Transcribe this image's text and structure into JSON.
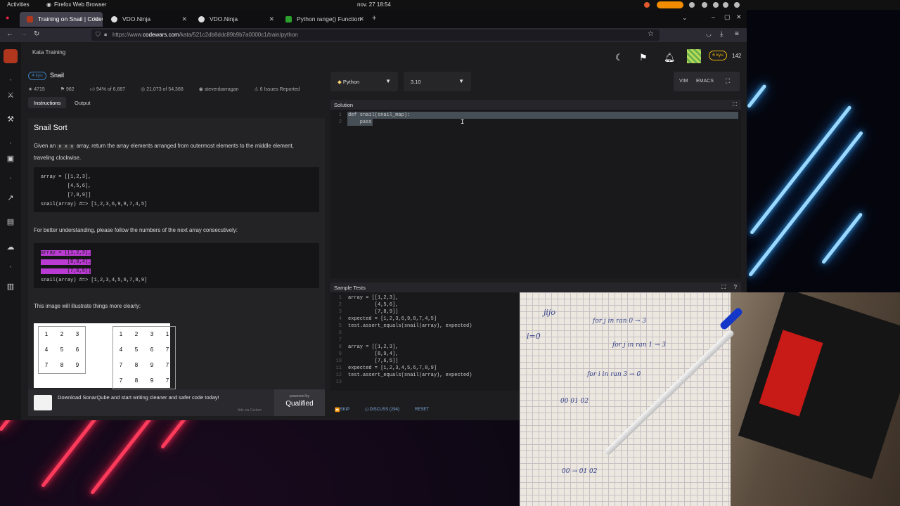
{
  "system_bar": {
    "activities": "Activities",
    "app": "Firefox Web Browser",
    "clock": "nov. 27  18:54"
  },
  "browser": {
    "tabs": [
      {
        "label": "Training on Snail | Codew",
        "color": "#b1361e"
      },
      {
        "label": "VDO.Ninja",
        "color": "#dddddd"
      },
      {
        "label": "VDO.Ninja",
        "color": "#dddddd"
      },
      {
        "label": "Python range() Function",
        "color": "#2ca02c"
      }
    ],
    "url_prefix": "https://www.",
    "url_domain": "codewars.com",
    "url_path": "/kata/521c2db8ddc89b9b7a0000c1/train/python"
  },
  "codewars": {
    "breadcrumb": "Kata Training",
    "rank": "6 kyu",
    "honor": "142",
    "kata": {
      "kyu": "4 kyu",
      "name": "Snail",
      "stars": "4715",
      "bookmarks": "962",
      "satisfaction": "94% of 6,687",
      "completed": "21,073 of 54,368",
      "author": "stevenbarragan",
      "issues": "6 Issues Reported"
    },
    "subtabs": [
      "Instructions",
      "Output"
    ],
    "description": {
      "title": "Snail Sort",
      "p1_before": "Given an",
      "p1_code": "n x n",
      "p1_after": "array, return the array elements arranged from outermost elements to the middle element, traveling clockwise.",
      "code1": "array = [[1,2,3],\n         [4,5,6],\n         [7,8,9]]\nsnail(array) #=> [1,2,3,6,9,8,7,4,5]",
      "p2": "For better understanding, please follow the numbers of the next array consecutively:",
      "code2_lines": [
        "array = [[1,2,3],",
        "         [8,9,4],",
        "         [7,6,5]]"
      ],
      "code2_last": "snail(array) #=> [1,2,3,4,5,6,7,8,9]",
      "p3": "This image will illustrate things more clearly:",
      "grid1": [
        "1",
        "2",
        "3",
        "4",
        "5",
        "6",
        "7",
        "8",
        "9"
      ],
      "grid2": [
        "1",
        "2",
        "3",
        "1",
        "4",
        "5",
        "6",
        "7",
        "7",
        "8",
        "9",
        "7",
        "7",
        "8",
        "9",
        "7"
      ]
    },
    "ad": {
      "text": "Download SonarQube and start writing cleaner and safer code today!",
      "small": "Ads via Carbon",
      "powered": "powered by",
      "brand": "Qualified"
    },
    "editor": {
      "language": "Python",
      "version": "3.10",
      "mode_vim": "VIM",
      "mode_emacs": "EMACS",
      "solution_title": "Solution",
      "solution_lines": [
        "def snail(snail_map):",
        "    pass"
      ],
      "tests_title": "Sample Tests",
      "test_lines": [
        "array = [[1,2,3],",
        "         [4,5,6],",
        "         [7,8,9]]",
        "expected = [1,2,3,6,9,8,7,4,5]",
        "test.assert_equals(snail(array), expected)",
        "",
        "",
        "array = [[1,2,3],",
        "         [8,9,4],",
        "         [7,6,5]]",
        "expected = [1,2,3,4,5,6,7,8,9]",
        "test.assert_equals(snail(array), expected)",
        ""
      ],
      "skip": "SKIP",
      "discuss": "DISCUSS (294)",
      "reset": "RESET"
    }
  },
  "webcam": {
    "notes": [
      "jijo",
      "i=0",
      "for j in ran 0 → 3",
      "for j in ran 1 → 3",
      "for i in ran 3 → 0",
      "00 01 02",
      "00 → 01 02"
    ]
  }
}
